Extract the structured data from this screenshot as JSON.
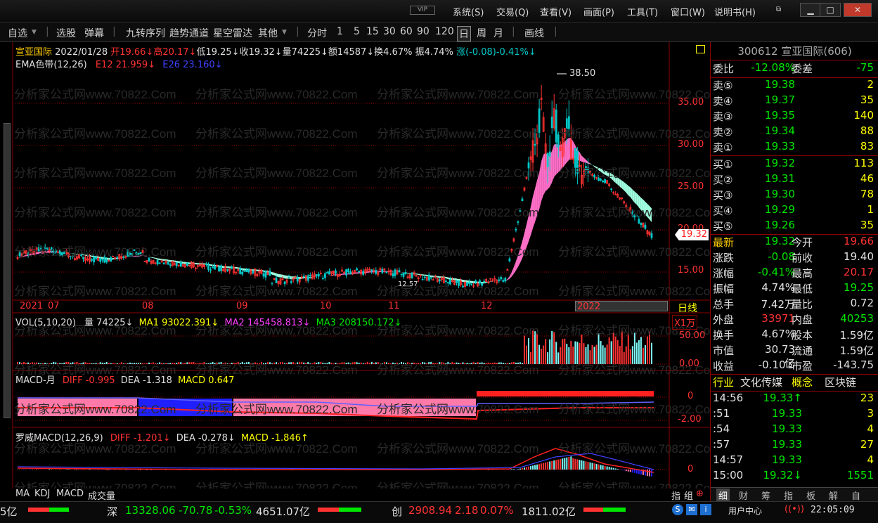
{
  "titlebar": {
    "vip": "VIP",
    "menus": [
      "系统(S)",
      "交易(Q)",
      "查看(V)",
      "画面(P)",
      "工具(T)",
      "窗口(W)",
      "说明书(H)"
    ]
  },
  "toolbar": {
    "items": [
      "自选",
      "选股",
      "弹幕",
      "九转序列",
      "趋势通道",
      "星空雷达",
      "其他",
      "分时",
      "1",
      "5",
      "15",
      "30",
      "60",
      "90",
      "120",
      "日",
      "周",
      "月",
      "画线"
    ],
    "active": "日"
  },
  "header": {
    "name": "宣亚国际",
    "date": "2022/01/28",
    "open": "开19.66↓",
    "high": "高20.17↓",
    "low": "低19.25↓",
    "close": "收19.32↓",
    "vol": "量74225↓",
    "amt": "额14587↓",
    "turn": "换4.67%",
    "amp": "振4.74%",
    "chg": "涨(-0.08)-0.41%↓"
  },
  "ema": {
    "label": "EMA色带(12,26)",
    "e12": "E12 21.959↓",
    "e26": "E26 23.160↓"
  },
  "price_axis": [
    "35.00",
    "30.00",
    "25.00",
    "20.00",
    "15.00"
  ],
  "price_peak": "38.50",
  "current_price": "19.32",
  "low_marker": "12.57",
  "time_axis": [
    "2021",
    "07",
    "08",
    "09",
    "10",
    "11",
    "12",
    "2022"
  ],
  "period_label": "日线",
  "vol": {
    "label": "VOL(5,10,20)",
    "v": "量 74225↓",
    "ma1": "MA1 93022.391↓",
    "ma2": "MA2 145458.813↓",
    "ma3": "MA3 208150.172↓",
    "unit": "X1万",
    "axis": [
      "50.00",
      "0.00"
    ]
  },
  "macd_month": {
    "label": "MACD-月",
    "diff": "DIFF -0.995",
    "dea": "DEA -1.318",
    "macd": "MACD 0.647",
    "axis": [
      "0",
      "-2.00"
    ]
  },
  "luowei": {
    "label": "罗威MACD(12,26,9)",
    "diff": "DIFF -1.201↓",
    "dea": "DEA -0.278↓",
    "macd": "MACD -1.846↑",
    "axis": [
      "0"
    ]
  },
  "bottom_tabs": [
    "MA",
    "KDJ",
    "MACD",
    "成交量"
  ],
  "bottom_right_tabs": [
    "指",
    "组"
  ],
  "right": {
    "code_title": "300612 宣亚国际(606)",
    "weibi": {
      "label": "委比",
      "value": "-12.08%",
      "label2": "委差",
      "value2": "-75"
    },
    "sells": [
      {
        "label": "卖⑤",
        "price": "19.38",
        "vol": "2"
      },
      {
        "label": "卖④",
        "price": "19.37",
        "vol": "35"
      },
      {
        "label": "卖③",
        "price": "19.35",
        "vol": "140"
      },
      {
        "label": "卖②",
        "price": "19.34",
        "vol": "88"
      },
      {
        "label": "卖①",
        "price": "19.33",
        "vol": "83"
      }
    ],
    "buys": [
      {
        "label": "买①",
        "price": "19.32",
        "vol": "113"
      },
      {
        "label": "买②",
        "price": "19.31",
        "vol": "46"
      },
      {
        "label": "买③",
        "price": "19.30",
        "vol": "78"
      },
      {
        "label": "买④",
        "price": "19.29",
        "vol": "1"
      },
      {
        "label": "买⑤",
        "price": "19.26",
        "vol": "35"
      }
    ],
    "stats": [
      {
        "l1": "最新",
        "v1": "19.32",
        "l2": "今开",
        "v2": "19.66"
      },
      {
        "l1": "涨跌",
        "v1": "-0.08",
        "l2": "前收",
        "v2": "19.40"
      },
      {
        "l1": "涨幅",
        "v1": "-0.41%",
        "l2": "最高",
        "v2": "20.17"
      },
      {
        "l1": "振幅",
        "v1": "4.74%",
        "l2": "最低",
        "v2": "19.25"
      },
      {
        "l1": "总手",
        "v1": "7.42万",
        "l2": "量比",
        "v2": "0.72"
      },
      {
        "l1": "外盘",
        "v1": "33971",
        "l2": "内盘",
        "v2": "40253"
      },
      {
        "l1": "换手",
        "v1": "4.67%",
        "l2": "股本",
        "v2": "1.59亿"
      },
      {
        "l1": "市值",
        "v1": "30.73亿",
        "l2": "流通",
        "v2": "1.59亿"
      },
      {
        "l1": "收益",
        "v1": "-0.10⑤",
        "l2": "市盈",
        "v2": "-143.75"
      }
    ],
    "industry": {
      "l1": "行业",
      "v1": "文化传媒",
      "l2": "概念",
      "v2": "区块链"
    },
    "ticks": [
      {
        "t": "14:56",
        "p": "19.33↑",
        "v": "23"
      },
      {
        "t": ":51",
        "p": "19.33",
        "v": "3"
      },
      {
        "t": ":54",
        "p": "19.33",
        "v": "4"
      },
      {
        "t": ":57",
        "p": "19.33",
        "v": "27"
      },
      {
        "t": "14:57",
        "p": "19.33",
        "v": "4"
      },
      {
        "t": "15:00",
        "p": "19.32↓",
        "v": "1551"
      }
    ],
    "tabs": [
      "细",
      "财",
      "筹",
      "指",
      "板",
      "解",
      "自"
    ]
  },
  "bottom": {
    "left": "5亿",
    "sz_label": "深",
    "sz_idx": "13328.06",
    "sz_chg": "-70.78",
    "sz_pct": "-0.53%",
    "sz_amt": "4651.07亿",
    "cy_label": "创",
    "cy_idx": "2908.94",
    "cy_chg": "2.18",
    "cy_pct": "0.07%",
    "cy_amt": "1811.02亿",
    "user_center": "用户中心",
    "time": "22:05:09"
  },
  "watermark": "分析家公式网www.70822.Com",
  "colors": {
    "up": "#ff3232",
    "down": "#00e600",
    "band_up": "#ff6ec7",
    "band_down": "#a0ffe0",
    "grid": "#8b0000"
  }
}
